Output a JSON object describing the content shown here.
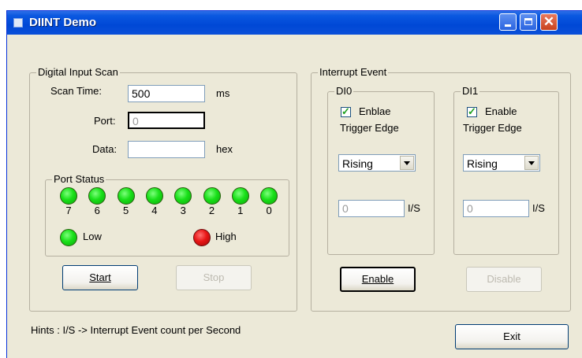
{
  "window": {
    "title": "DIINT Demo"
  },
  "scan": {
    "legend": "Digital Input Scan",
    "scan_time_label": "Scan Time:",
    "scan_time_value": "500",
    "scan_time_unit": "ms",
    "port_label": "Port:",
    "port_value": "0",
    "data_label": "Data:",
    "data_value": "",
    "data_unit": "hex"
  },
  "port_status": {
    "legend": "Port Status",
    "bits": [
      {
        "label": "7",
        "state": "low"
      },
      {
        "label": "6",
        "state": "low"
      },
      {
        "label": "5",
        "state": "low"
      },
      {
        "label": "4",
        "state": "low"
      },
      {
        "label": "3",
        "state": "low"
      },
      {
        "label": "2",
        "state": "low"
      },
      {
        "label": "1",
        "state": "low"
      },
      {
        "label": "0",
        "state": "low"
      }
    ],
    "legend_low": "Low",
    "legend_high": "High",
    "low_color": "#19e019",
    "high_color": "#e81616"
  },
  "scan_buttons": {
    "start": "Start",
    "stop": "Stop"
  },
  "interrupt": {
    "legend": "Interrupt Event",
    "di0": {
      "legend": "DI0",
      "enable_label": "Enblae",
      "enabled": true,
      "trigger_label": "Trigger Edge",
      "edge": "Rising",
      "count": "0",
      "unit": "I/S"
    },
    "di1": {
      "legend": "DI1",
      "enable_label": "Enable",
      "enabled": true,
      "trigger_label": "Trigger Edge",
      "edge": "Rising",
      "count": "0",
      "unit": "I/S"
    },
    "enable_button": "Enable",
    "disable_button": "Disable"
  },
  "hint": "Hints : I/S -> Interrupt Event count per Second",
  "exit_button": "Exit"
}
